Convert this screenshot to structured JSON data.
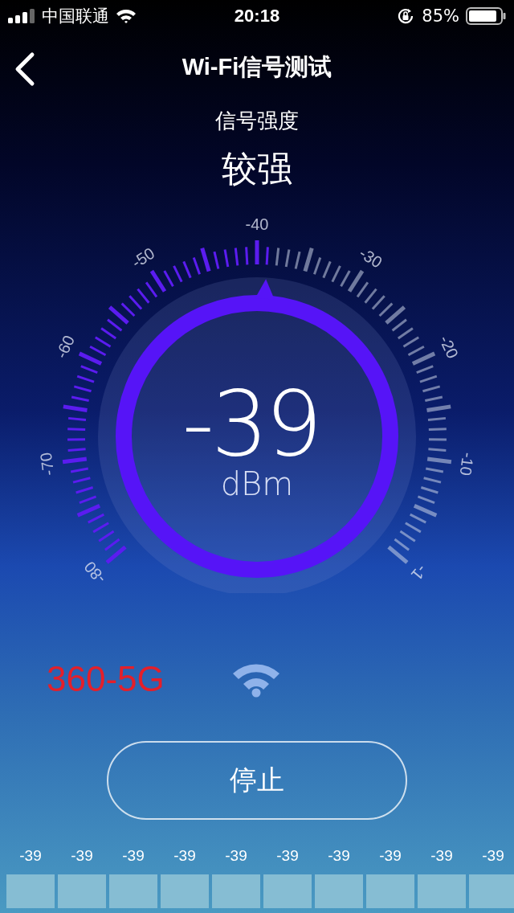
{
  "status_bar": {
    "carrier": "中国联通",
    "time": "20:18",
    "battery": "85%"
  },
  "header": {
    "title": "Wi-Fi信号测试"
  },
  "signal": {
    "label": "信号强度",
    "quality": "较强"
  },
  "gauge": {
    "scale_labels": [
      "-80",
      "-70",
      "-60",
      "-50",
      "-40",
      "-30",
      "-20",
      "-10",
      "-1"
    ],
    "reading": "-39",
    "unit": "dBm"
  },
  "network": {
    "name": "360-5G"
  },
  "stop_button": {
    "label": "停止"
  },
  "history": [
    "-39",
    "-39",
    "-39",
    "-39",
    "-39",
    "-39",
    "-39",
    "-39",
    "-39",
    "-39"
  ]
}
